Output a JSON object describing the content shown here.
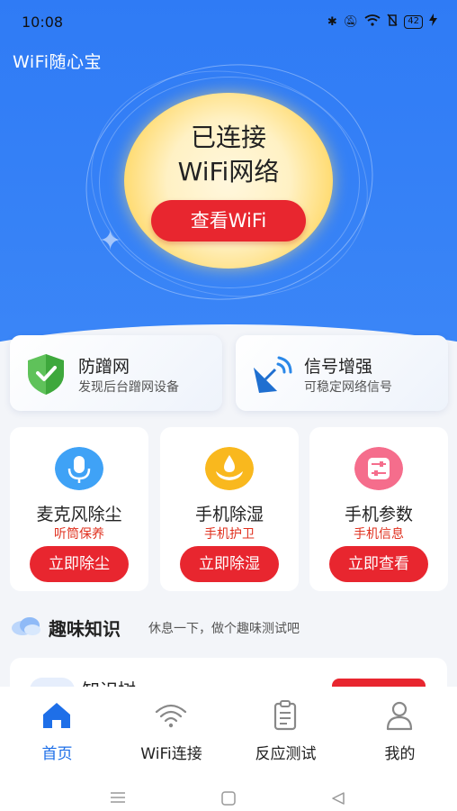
{
  "status_bar": {
    "time": "10:08",
    "battery": "42",
    "icons": [
      "bluetooth-icon",
      "mute-icon",
      "wifi-icon",
      "no-sim-icon",
      "battery-icon",
      "charging-icon"
    ]
  },
  "app": {
    "title": "WiFi随心宝"
  },
  "hero": {
    "status_line1": "已连接",
    "status_line2": "WiFi网络",
    "view_button": "查看WiFi"
  },
  "features": [
    {
      "title": "防蹭网",
      "subtitle": "发现后台蹭网设备",
      "icon": "shield-icon"
    },
    {
      "title": "信号增强",
      "subtitle": "可稳定网络信号",
      "icon": "satellite-dish-icon"
    }
  ],
  "tools": [
    {
      "title": "麦克风除尘",
      "subtitle": "听筒保养",
      "button": "立即除尘",
      "icon": "microphone-icon",
      "color": "#3fa2f6"
    },
    {
      "title": "手机除湿",
      "subtitle": "手机护卫",
      "button": "立即除湿",
      "icon": "water-drop-icon",
      "color": "#f9b81e"
    },
    {
      "title": "手机参数",
      "subtitle": "手机信息",
      "button": "立即查看",
      "icon": "sliders-icon",
      "color": "#f56d8c"
    }
  ],
  "fun": {
    "title": "趣味知识",
    "subtitle": "休息一下，做个趣味测试吧"
  },
  "quiz": {
    "title": "知识树"
  },
  "nav": [
    {
      "label": "首页",
      "icon": "home-icon",
      "active": true
    },
    {
      "label": "WiFi连接",
      "icon": "wifi-icon",
      "active": false
    },
    {
      "label": "反应测试",
      "icon": "clipboard-icon",
      "active": false
    },
    {
      "label": "我的",
      "icon": "user-icon",
      "active": false
    }
  ],
  "colors": {
    "primary": "#2f7bf5",
    "accent": "#e8262f",
    "active_nav": "#1e6fe8"
  }
}
